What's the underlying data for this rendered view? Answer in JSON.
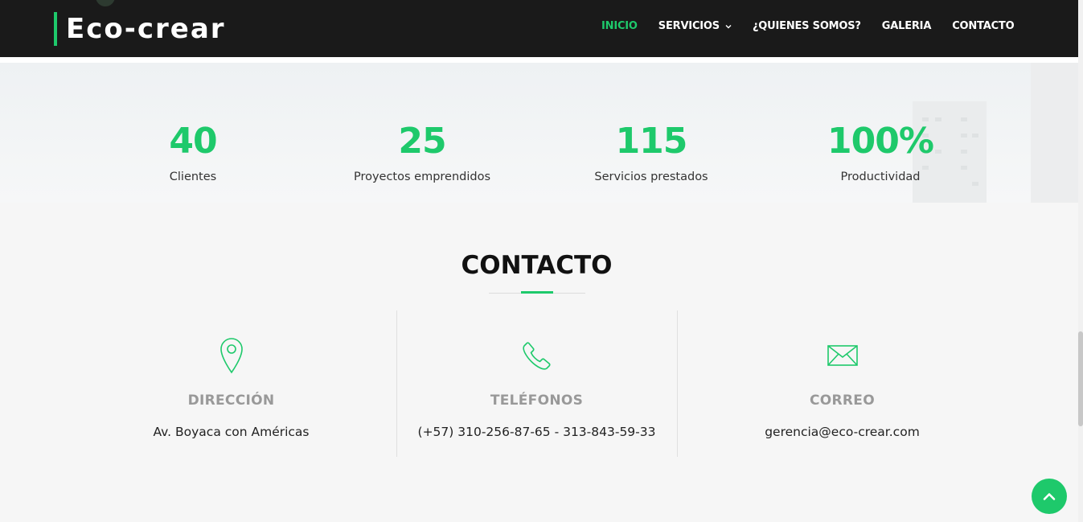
{
  "brand": {
    "name": "Eco-crear",
    "accent": "#1ec96b",
    "header_bg": "#1a1a1a"
  },
  "nav": {
    "items": [
      {
        "label": "INICIO",
        "active": true
      },
      {
        "label": "SERVICIOS",
        "has_dropdown": true
      },
      {
        "label": "¿QUIENES SOMOS?"
      },
      {
        "label": "GALERIA"
      },
      {
        "label": "CONTACTO"
      }
    ]
  },
  "stats": [
    {
      "value": "40",
      "label": "Clientes"
    },
    {
      "value": "25",
      "label": "Proyectos emprendidos"
    },
    {
      "value": "115",
      "label": "Servicios prestados"
    },
    {
      "value": "100%",
      "label": "Productividad"
    }
  ],
  "contact": {
    "title": "CONTACTO",
    "columns": [
      {
        "icon": "map-pin-icon",
        "heading": "DIRECCIÓN",
        "value": "Av. Boyaca con Américas"
      },
      {
        "icon": "phone-icon",
        "heading": "TELÉFONOS",
        "value": "(+57) 310-256-87-65 - 313-843-59-33"
      },
      {
        "icon": "envelope-icon",
        "heading": "CORREO",
        "value": "gerencia@eco-crear.com"
      }
    ]
  },
  "back_to_top": {
    "icon": "chevron-up-icon"
  }
}
